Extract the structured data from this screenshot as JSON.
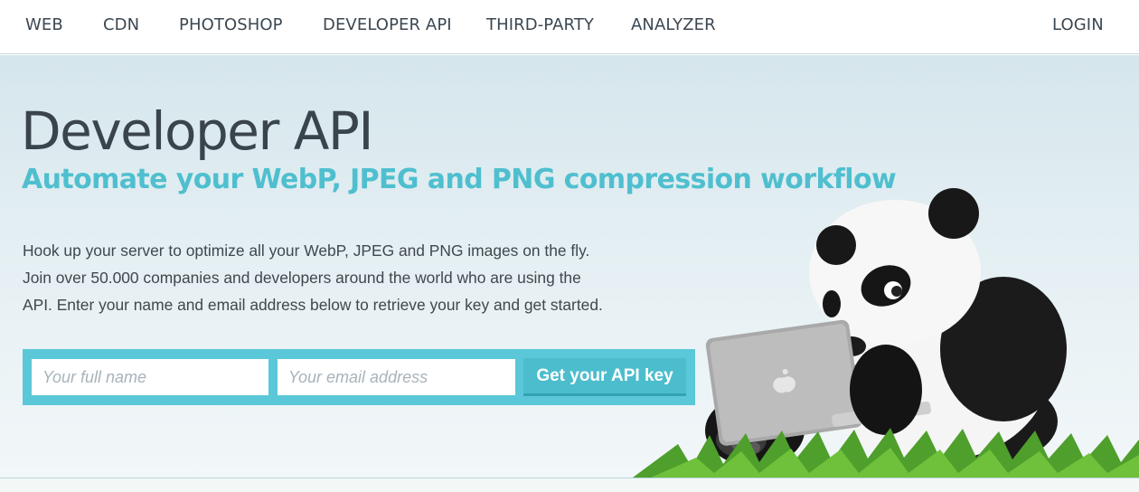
{
  "nav": {
    "links": [
      {
        "label": "WEB"
      },
      {
        "label": "CDN"
      },
      {
        "label": "PHOTOSHOP"
      },
      {
        "label": "DEVELOPER API"
      },
      {
        "label": "THIRD-PARTY"
      },
      {
        "label": "ANALYZER"
      }
    ],
    "login_label": "LOGIN"
  },
  "hero": {
    "title": "Developer API",
    "subtitle": "Automate your WebP, JPEG and PNG compression workflow",
    "intro_lines": [
      "Hook up your server to optimize all your WebP, JPEG and PNG images on the fly.",
      "Join over 50.000 companies and developers around the world who are using the",
      "API. Enter your name and email address below to retrieve your key and get started."
    ]
  },
  "signup": {
    "name_placeholder": "Your full name",
    "email_placeholder": "Your email address",
    "button_label": "Get your API key"
  },
  "illustration": {
    "subject": "panda-with-laptop",
    "colors": {
      "accent": "#5ac8d8",
      "title": "#3a444c",
      "subtitle": "#4fbfcf"
    }
  }
}
